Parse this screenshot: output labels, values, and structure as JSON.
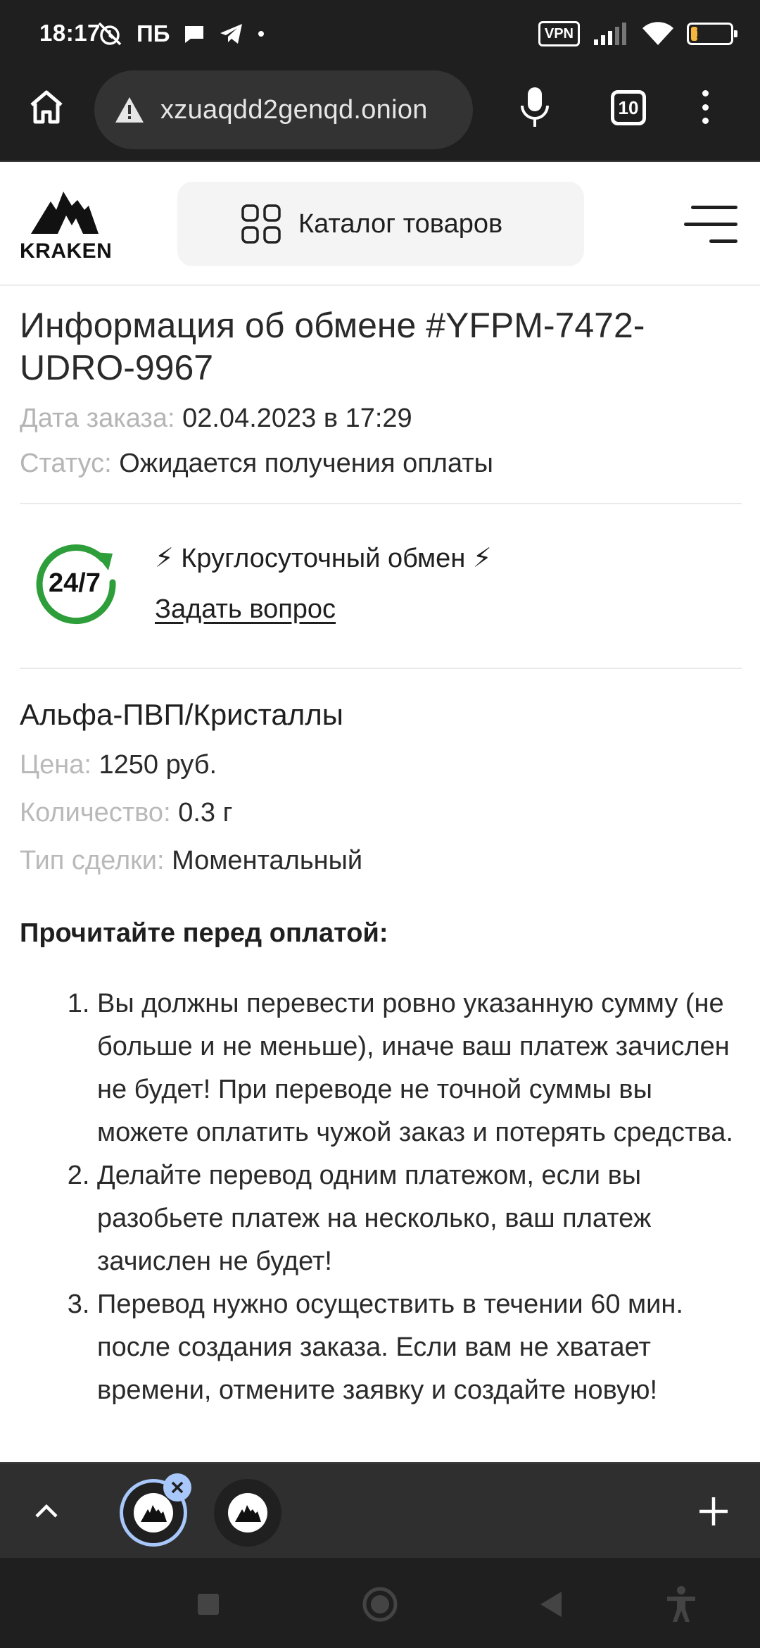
{
  "status_bar": {
    "time": "18:17",
    "carrier": "ПБ",
    "vpn": "VPN",
    "battery": "17",
    "battery_level": 0.17
  },
  "browser": {
    "url": "xzuaqdd2genqd.onion",
    "tab_count": "10"
  },
  "site": {
    "logo_text": "KRAKEN",
    "catalog_label": "Каталог товаров"
  },
  "order": {
    "title": "Информация об обмене #YFPM-7472-UDRO-9967",
    "date_label": "Дата заказа:",
    "date_value": "02.04.2023 в 17:29",
    "status_label": "Статус:",
    "status_value": "Ожидается получения оплаты"
  },
  "support": {
    "badge_text": "24/7",
    "title": "⚡ Круглосуточный обмен ⚡",
    "ask_link": "Задать вопрос"
  },
  "product": {
    "name": "Альфа-ПВП/Кристаллы",
    "price_label": "Цена:",
    "price_value": "1250 руб.",
    "qty_label": "Количество:",
    "qty_value": "0.3 г",
    "deal_label": "Тип сделки:",
    "deal_value": "Моментальный"
  },
  "instructions": {
    "title": "Прочитайте перед оплатой:",
    "items": [
      "Вы должны перевести ровно указанную сумму (не больше и не меньше), иначе ваш платеж зачислен не будет! При переводе не точной суммы вы можете оплатить чужой заказ и потерять средства.",
      "Делайте перевод одним платежом, если вы разобьете платеж на несколько, ваш платеж зачислен не будет!",
      "Перевод нужно осуществить в течении 60 мин. после создания заказа. Если вам не хватает времени, отмените заявку и создайте новую!"
    ]
  },
  "colors": {
    "browser_dark": "#1f1f1f",
    "accent_tab": "#a8c7fa",
    "badge_green": "#2e9e3a",
    "muted_label": "#b5b5b5"
  }
}
